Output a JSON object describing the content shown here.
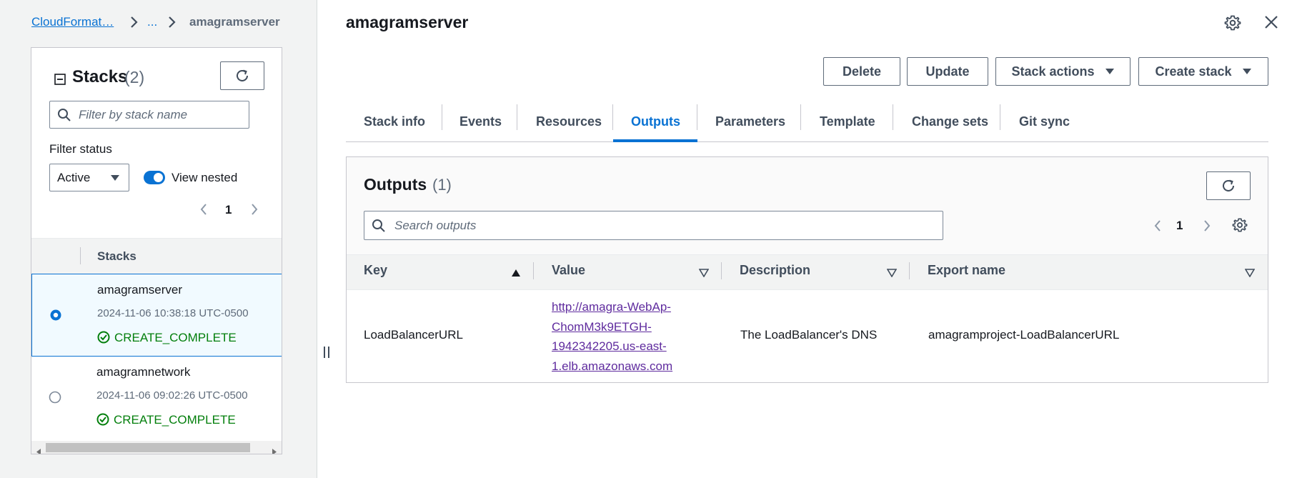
{
  "breadcrumb": {
    "root": "CloudFormat…",
    "sep": "›",
    "ellipsis": "...",
    "current": "amagramserver"
  },
  "stacks_panel": {
    "title": "Stacks",
    "count": "(2)",
    "filter_placeholder": "Filter by stack name",
    "filter_status_label": "Filter status",
    "status_select": "Active",
    "view_nested_label": "View nested",
    "view_nested_on": true,
    "page": "1",
    "column_header": "Stacks",
    "stacks": [
      {
        "name": "amagramserver",
        "date": "2024-11-06 10:38:18 UTC-0500",
        "status": "CREATE_COMPLETE",
        "selected": true
      },
      {
        "name": "amagramnetwork",
        "date": "2024-11-06 09:02:26 UTC-0500",
        "status": "CREATE_COMPLETE",
        "selected": false
      }
    ]
  },
  "detail": {
    "title": "amagramserver",
    "buttons": {
      "delete": "Delete",
      "update": "Update",
      "stack_actions": "Stack actions",
      "create_stack": "Create stack"
    },
    "tabs": [
      "Stack info",
      "Events",
      "Resources",
      "Outputs",
      "Parameters",
      "Template",
      "Change sets",
      "Git sync"
    ],
    "active_tab": "Outputs"
  },
  "outputs": {
    "title": "Outputs",
    "count": "(1)",
    "search_placeholder": "Search outputs",
    "page": "1",
    "columns": {
      "key": "Key",
      "value": "Value",
      "description": "Description",
      "export": "Export name"
    },
    "rows": [
      {
        "key": "LoadBalancerURL",
        "value_lines": [
          "http://amagra-WebAp-",
          "ChomM3k9ETGH-",
          "1942342205.us-east-",
          "1.elb.amazonaws.com"
        ],
        "description": "The LoadBalancer's DNS",
        "export": "amagramproject-LoadBalancerURL"
      }
    ]
  },
  "colors": {
    "accent": "#0972d3",
    "success": "#037f0c",
    "link_visited": "#5f2b9e"
  }
}
